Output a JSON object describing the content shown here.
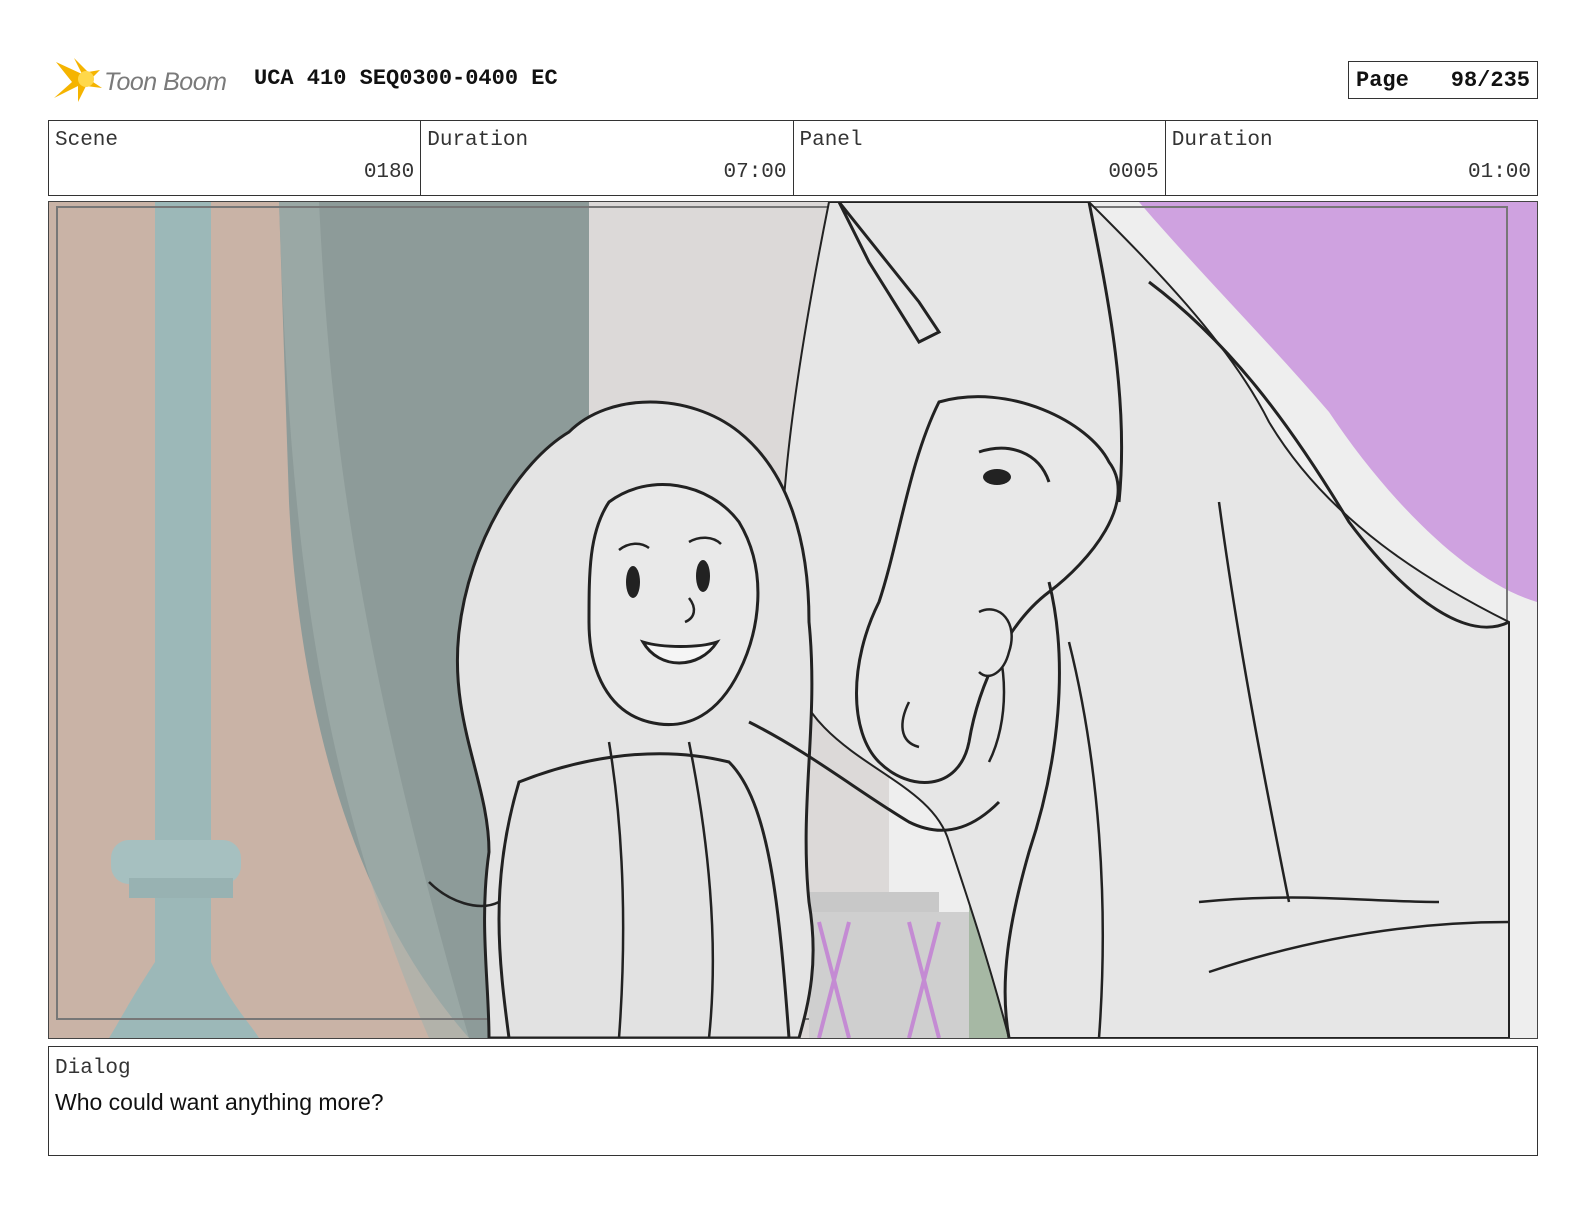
{
  "header": {
    "logo_text": "Toon Boom",
    "title": "UCA 410 SEQ0300-0400 EC",
    "page_label": "Page",
    "page_value": "98/235"
  },
  "info": {
    "scene_label": "Scene",
    "scene_value": "0180",
    "duration_label": "Duration",
    "duration_value": "07:00",
    "panel_label": "Panel",
    "panel_value": "0005",
    "panel_duration_label": "Duration",
    "panel_duration_value": "01:00"
  },
  "dialog": {
    "label": "Dialog",
    "text": "Who could want anything more?"
  },
  "colors": {
    "logo_star": "#f5b400",
    "background_purple": "#cfa2e0",
    "pillar_teal": "#9cb8b8",
    "curtain_gray": "#8c9a99"
  },
  "icons": {
    "logo": "toon-boom-star-logo"
  }
}
